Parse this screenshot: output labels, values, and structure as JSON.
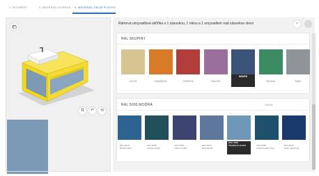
{
  "tabs": [
    {
      "label": "1. ROZMĚRY"
    },
    {
      "label": "2. MATERIÁL KORPUS"
    },
    {
      "label": "3. MATERIÁL ČELNÍ PLOCHY"
    }
  ],
  "header": {
    "title": "Rámová umyvadlová skříňka s 1 zásuvkou, 1 nikou a 1 umyvadlem nad zásuvkou vlevo"
  },
  "viewer": {
    "toolbar_icon": "layers-icon"
  },
  "ral_group": {
    "title": "RAL SKUPINY",
    "swatches": [
      {
        "label": "ŽLUTÁ",
        "color": "#d5c48f",
        "selected": false
      },
      {
        "label": "ORANŽOVÁ",
        "color": "#d87a27",
        "selected": false
      },
      {
        "label": "ČERVENÁ",
        "color": "#b33d3a",
        "selected": false
      },
      {
        "label": "FIALOVÁ",
        "color": "#9a6e9d",
        "selected": false
      },
      {
        "label": "MODRÁ",
        "color": "#3b5377",
        "selected": true
      },
      {
        "label": "ZELENÁ",
        "color": "#3d8b62",
        "selected": false
      },
      {
        "label": "ŠEDÁ",
        "color": "#8e9497",
        "selected": false
      }
    ]
  },
  "ral_5000": {
    "title": "RAL 5000 MODRÁ",
    "hint": "Hledat",
    "swatches": [
      {
        "code": "RAL 5019",
        "name": "Modrá Capri",
        "color": "#2e6391",
        "selected": false
      },
      {
        "code": "RAL 5020",
        "name": "Modrá zaoká",
        "color": "#22505a",
        "selected": false
      },
      {
        "code": "RAL 5022",
        "name": "Noční modrá",
        "color": "#3e4470",
        "selected": false
      },
      {
        "code": "RAL 5023",
        "name": "Modrošedá",
        "color": "#5d789a",
        "selected": false
      },
      {
        "code": "RAL 5024",
        "name": "Pastelově modrá",
        "color": "#6f98b8",
        "selected": true
      },
      {
        "code": "RAL 5025",
        "name": "Pearl Gentian blue",
        "color": "#1d506a",
        "selected": false
      },
      {
        "code": "RAL 5026",
        "name": "Pearl night blue",
        "color": "#1a3a6e",
        "selected": false
      }
    ]
  },
  "colors": {
    "accent": "#2f6fb1",
    "front_selected": "#7c99b6",
    "frame": "#f2d92e"
  }
}
